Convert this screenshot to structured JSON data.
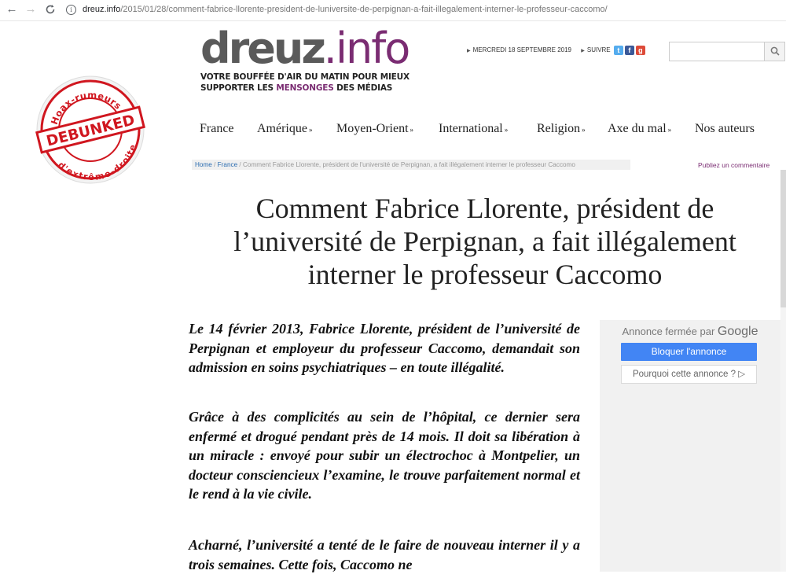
{
  "browser": {
    "back_icon": "←",
    "forward_icon": "→",
    "reload_icon": "C",
    "url_domain": "dreuz.info",
    "url_path": "/2015/01/28/comment-fabrice-llorente-president-de-luniversite-de-perpignan-a-fait-illegalement-interner-le-professeur-caccomo/"
  },
  "stamp": {
    "top_text": "Hoax-rumeurs",
    "center_text": "DEBUNKED",
    "bottom_text": "d'extrême-droite",
    "color": "#d0161f"
  },
  "header": {
    "logo_part1": "dreuz",
    "logo_part2": ".info",
    "tagline_line1": "VOTRE BOUFFÉE D'AIR DU MATIN POUR MIEUX",
    "tagline_line2_a": "SUPPORTER LES ",
    "tagline_line2_hl": "MENSONGES",
    "tagline_line2_b": " DES MÉDIAS",
    "date": "MERCREDI 18 SEPTEMBRE 2019",
    "follow": "SUIVRE",
    "brand_color": "#7a2c72"
  },
  "nav": {
    "items": [
      {
        "label": "France",
        "arrow": ""
      },
      {
        "label": "Amérique",
        "arrow": "»"
      },
      {
        "label": "Moyen-Orient",
        "arrow": "»"
      },
      {
        "label": "International",
        "arrow": "»"
      },
      {
        "label": "Religion",
        "arrow": "»"
      },
      {
        "label": "Axe du mal",
        "arrow": "»"
      },
      {
        "label": "Nos auteurs",
        "arrow": ""
      }
    ]
  },
  "breadcrumb": {
    "home": "Home",
    "sep": " / ",
    "category": "France",
    "current": "Comment Fabrice Llorente, président de l'université de Perpignan, a fait illégalement interner le professeur Caccomo",
    "comment_link": "Publiez un commentaire"
  },
  "article": {
    "title": "Comment Fabrice Llorente, président de l’université de Perpignan, a fait illégalement interner le professeur Caccomo",
    "paragraphs": [
      "Le 14 février 2013, Fabrice Llorente, président de l’université de Perpignan et employeur du professeur Caccomo, demandait son admission en soins psychiatriques – en toute illégalité.",
      "Grâce à des complicités au sein de l’hôpital, ce dernier sera enfermé et drogué pendant près de 14 mois. Il doit sa libération à un miracle : envoyé pour subir un électrochoc à Montpelier, un docteur consciencieux l’examine, le trouve parfaitement normal et le rend à la vie civile.",
      "Acharné, l’université a tenté de le faire de nouveau interner il y a trois semaines. Cette fois, Caccomo ne"
    ]
  },
  "ad": {
    "closed_by": "Annonce fermée par",
    "google": "Google",
    "block_label": "Bloquer l'annonce",
    "why_label": "Pourquoi cette annonce ? ▷"
  }
}
